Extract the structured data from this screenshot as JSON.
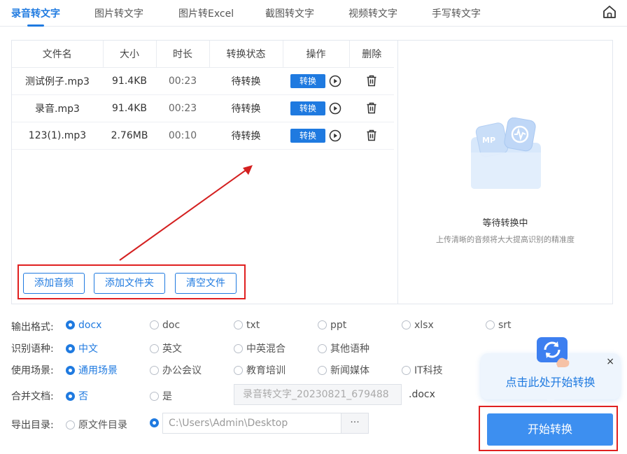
{
  "tabs": [
    {
      "label": "录音转文字",
      "active": true
    },
    {
      "label": "图片转文字"
    },
    {
      "label": "图片转Excel"
    },
    {
      "label": "截图转文字"
    },
    {
      "label": "视频转文字"
    },
    {
      "label": "手写转文字"
    }
  ],
  "table": {
    "headers": [
      "文件名",
      "大小",
      "时长",
      "转换状态",
      "操作",
      "删除"
    ],
    "rows": [
      {
        "name": "测试例子.mp3",
        "size": "91.4KB",
        "duration": "00:23",
        "status": "待转换",
        "action": "转换"
      },
      {
        "name": "录音.mp3",
        "size": "91.4KB",
        "duration": "00:23",
        "status": "待转换",
        "action": "转换"
      },
      {
        "name": "123(1).mp3",
        "size": "2.76MB",
        "duration": "00:10",
        "status": "待转换",
        "action": "转换"
      }
    ]
  },
  "actions": {
    "add_audio": "添加音频",
    "add_folder": "添加文件夹",
    "clear": "清空文件"
  },
  "placeholder": {
    "title": "等待转换中",
    "subtitle": "上传清晰的音频将大大提高识别的精准度",
    "badge": "MP"
  },
  "options": {
    "format": {
      "label": "输出格式:",
      "choices": [
        "docx",
        "doc",
        "txt",
        "ppt",
        "xlsx",
        "srt"
      ],
      "selected": "docx"
    },
    "language": {
      "label": "识别语种:",
      "choices": [
        "中文",
        "英文",
        "中英混合",
        "其他语种"
      ],
      "selected": "中文"
    },
    "scene": {
      "label": "使用场景:",
      "choices": [
        "通用场景",
        "办公会议",
        "教育培训",
        "新闻媒体",
        "IT科技"
      ],
      "selected": "通用场景"
    },
    "merge": {
      "label": "合并文档:",
      "choices": [
        "否",
        "是"
      ],
      "selected": "否",
      "filename": "录音转文字_20230821_679488",
      "ext": ".docx"
    },
    "export": {
      "label": "导出目录:",
      "choices": [
        "原文件目录",
        ""
      ],
      "path": "C:\\Users\\Admin\\Desktop",
      "more": "···"
    }
  },
  "tip": {
    "text": "点击此处开始转换",
    "close": "×"
  },
  "start_button": "开始转换",
  "colors": {
    "accent": "#1f7ae0",
    "highlight_red": "#e02020",
    "start_button": "#3d8ff0"
  }
}
